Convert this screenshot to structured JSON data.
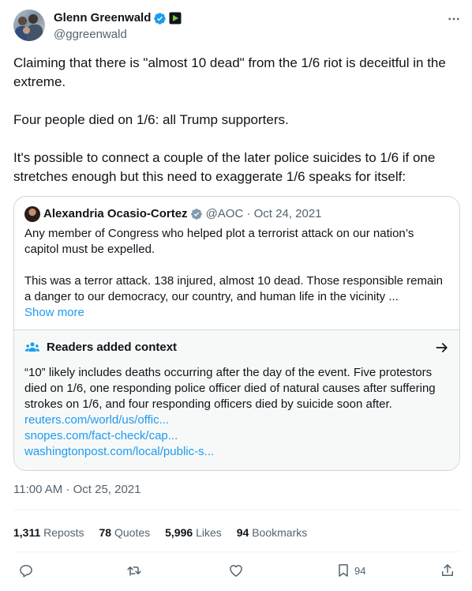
{
  "author": {
    "name": "Glenn Greenwald",
    "handle": "@ggreenwald"
  },
  "tweet": {
    "paragraphs": [
      "Claiming that there is \"almost 10 dead\" from the 1/6 riot is deceitful in the extreme.",
      "Four people died on 1/6: all Trump supporters.",
      "It's possible to connect a couple of the later police suicides to 1/6 if one stretches enough but this need to exaggerate 1/6 speaks for itself:"
    ]
  },
  "quote": {
    "name": "Alexandria Ocasio-Cortez",
    "meta": "@AOC · Oct 24, 2021",
    "paragraphs": [
      "Any member of Congress who helped plot a terrorist attack on our nation’s capitol must be expelled.",
      "This was a terror attack. 138 injured, almost 10 dead. Those responsible remain a danger to our democracy, our country, and human life in the vicinity ..."
    ],
    "show_more": "Show more",
    "context": {
      "title": "Readers added context",
      "text": "“10” likely includes deaths occurring after the day of the event. Five protestors died on 1/6, one responding police officer died of natural causes after suffering strokes on 1/6, and four responding officers died by suicide soon after.",
      "links": [
        "reuters.com/world/us/offic...",
        "snopes.com/fact-check/cap...",
        "washingtonpost.com/local/public-s..."
      ]
    }
  },
  "timestamp": "11:00 AM · Oct 25, 2021",
  "stats": {
    "reposts": {
      "count": "1,311",
      "label": "Reposts"
    },
    "quotes": {
      "count": "78",
      "label": "Quotes"
    },
    "likes": {
      "count": "5,996",
      "label": "Likes"
    },
    "bookmarks": {
      "count": "94",
      "label": "Bookmarks"
    }
  },
  "actions": {
    "bookmark_count": "94",
    "icons": [
      "reply-icon",
      "repost-icon",
      "like-icon",
      "bookmark-icon",
      "share-icon"
    ]
  },
  "colors": {
    "text": "#0f1419",
    "muted": "#536471",
    "link": "#1d9bf0",
    "border": "#cfd9de",
    "context_bg": "#f7f9f9"
  }
}
